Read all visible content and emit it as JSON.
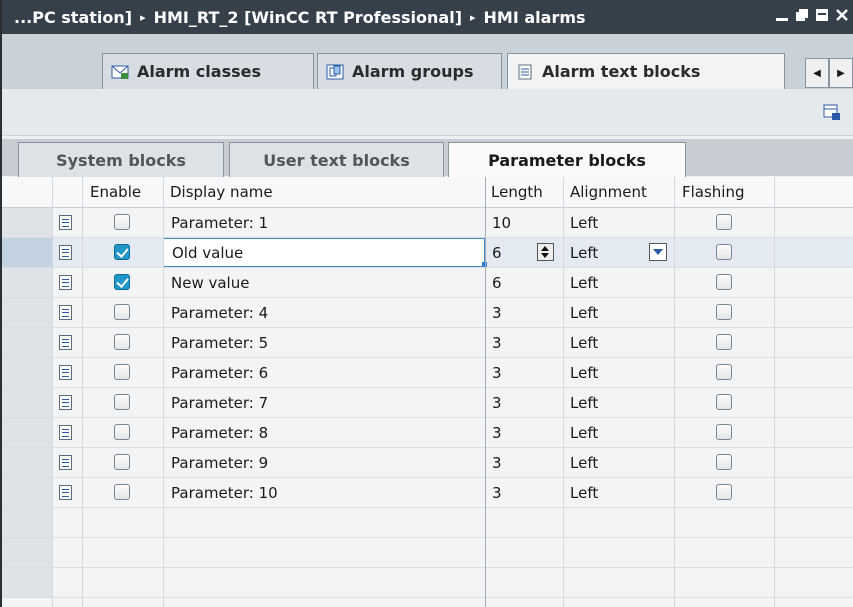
{
  "title": {
    "crumbs": [
      "...PC station]",
      "HMI_RT_2 [WinCC RT Professional]",
      "HMI alarms"
    ],
    "separator": "▸"
  },
  "editor_tabs": [
    {
      "label": "Alarm classes",
      "icon": "alarm-classes-icon"
    },
    {
      "label": "Alarm groups",
      "icon": "alarm-groups-icon"
    },
    {
      "label": "Alarm text blocks",
      "icon": "text-blocks-icon",
      "active": true
    }
  ],
  "sub_tabs": [
    {
      "label": "System blocks"
    },
    {
      "label": "User text blocks"
    },
    {
      "label": "Parameter blocks",
      "active": true
    }
  ],
  "columns": {
    "enable": "Enable",
    "display_name": "Display name",
    "length": "Length",
    "alignment": "Alignment",
    "flashing": "Flashing"
  },
  "rows": [
    {
      "enable": false,
      "display_name": "Parameter: 1",
      "length": "10",
      "alignment": "Left",
      "flashing": false
    },
    {
      "enable": true,
      "display_name": "Old value",
      "length": "6",
      "alignment": "Left",
      "flashing": false,
      "selected": true
    },
    {
      "enable": true,
      "display_name": "New value",
      "length": "6",
      "alignment": "Left",
      "flashing": false
    },
    {
      "enable": false,
      "display_name": "Parameter: 4",
      "length": "3",
      "alignment": "Left",
      "flashing": false
    },
    {
      "enable": false,
      "display_name": "Parameter: 5",
      "length": "3",
      "alignment": "Left",
      "flashing": false
    },
    {
      "enable": false,
      "display_name": "Parameter: 6",
      "length": "3",
      "alignment": "Left",
      "flashing": false
    },
    {
      "enable": false,
      "display_name": "Parameter: 7",
      "length": "3",
      "alignment": "Left",
      "flashing": false
    },
    {
      "enable": false,
      "display_name": "Parameter: 8",
      "length": "3",
      "alignment": "Left",
      "flashing": false
    },
    {
      "enable": false,
      "display_name": "Parameter: 9",
      "length": "3",
      "alignment": "Left",
      "flashing": false
    },
    {
      "enable": false,
      "display_name": "Parameter: 10",
      "length": "3",
      "alignment": "Left",
      "flashing": false
    }
  ],
  "colors": {
    "titlebar": "#36404a",
    "checked": "#2196c8",
    "accent": "#2a7fd4"
  }
}
